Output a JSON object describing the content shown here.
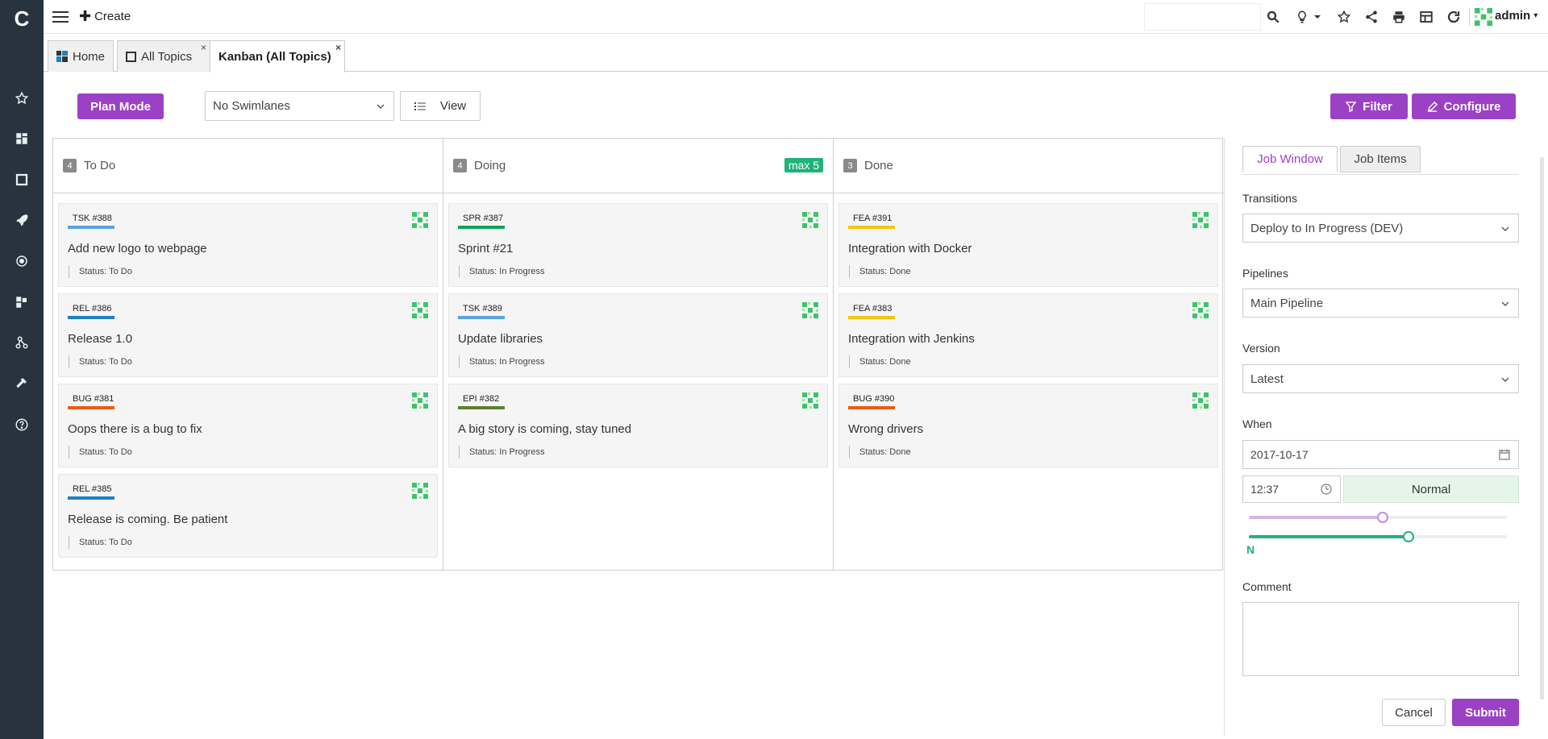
{
  "logo_letter": "C",
  "topbar": {
    "create_label": "Create",
    "user": "admin",
    "user_caret": "▾",
    "icons": [
      "search-icon",
      "lightbulb-icon",
      "star-icon",
      "share-icon",
      "print-icon",
      "layout-icon",
      "refresh-icon"
    ]
  },
  "sidebar": {
    "icons": [
      "star-icon",
      "dashboard-icon",
      "square-icon",
      "rocket-icon",
      "target-icon",
      "widgets-icon",
      "flow-icon",
      "hammer-icon",
      "help-icon"
    ]
  },
  "tabs": [
    {
      "label": "Home",
      "closable": false
    },
    {
      "label": "All Topics",
      "closable": true,
      "close": "×"
    },
    {
      "label": "Kanban (All Topics)",
      "closable": true,
      "close": "×"
    }
  ],
  "toolbar": {
    "plan_mode": "Plan Mode",
    "swimlanes": "No Swimlanes",
    "view": "View",
    "filter": "Filter",
    "configure": "Configure"
  },
  "colors": {
    "accent": "#9b41c6",
    "green": "#1fb37a",
    "tsk": "#5ba4e0",
    "rel": "#1f7fc4",
    "bug": "#ef5a14",
    "spr": "#12a15b",
    "epi": "#5c7f2c",
    "fea": "#f3c515"
  },
  "columns": [
    {
      "title": "To Do",
      "count": "4",
      "wip": "",
      "cards": [
        {
          "key": "TSK #388",
          "type": "tsk",
          "title": "Add new logo to webpage",
          "status": "Status: To Do"
        },
        {
          "key": "REL #386",
          "type": "rel",
          "title": "Release 1.0",
          "status": "Status: To Do"
        },
        {
          "key": "BUG #381",
          "type": "bug",
          "title": "Oops there is a bug to fix",
          "status": "Status: To Do"
        },
        {
          "key": "REL #385",
          "type": "rel",
          "title": "Release is coming. Be patient",
          "status": "Status: To Do"
        }
      ]
    },
    {
      "title": "Doing",
      "count": "4",
      "wip": "max 5",
      "cards": [
        {
          "key": "SPR #387",
          "type": "spr",
          "title": "Sprint #21",
          "status": "Status: In Progress"
        },
        {
          "key": "TSK #389",
          "type": "tsk",
          "title": "Update libraries",
          "status": "Status: In Progress"
        },
        {
          "key": "EPI #382",
          "type": "epi",
          "title": "A big story is coming, stay tuned",
          "status": "Status: In Progress"
        }
      ]
    },
    {
      "title": "Done",
      "count": "3",
      "wip": "",
      "cards": [
        {
          "key": "FEA #391",
          "type": "fea",
          "title": "Integration with Docker",
          "status": "Status: Done"
        },
        {
          "key": "FEA #383",
          "type": "fea",
          "title": "Integration with Jenkins",
          "status": "Status: Done"
        },
        {
          "key": "BUG #390",
          "type": "bug",
          "title": "Wrong drivers",
          "status": "Status: Done"
        }
      ]
    }
  ],
  "panel": {
    "tab_job_window": "Job Window",
    "tab_job_items": "Job Items",
    "transitions_label": "Transitions",
    "transitions_value": "Deploy to In Progress (DEV)",
    "pipelines_label": "Pipelines",
    "pipelines_value": "Main Pipeline",
    "version_label": "Version",
    "version_value": "Latest",
    "when_label": "When",
    "date_value": "2017-10-17",
    "time_value": "12:37",
    "priority_value": "Normal",
    "slider1_fraction": 0.52,
    "slider2_fraction": 0.62,
    "slider_letter": "N",
    "comment_label": "Comment",
    "comment_value": "",
    "cancel": "Cancel",
    "submit": "Submit"
  }
}
